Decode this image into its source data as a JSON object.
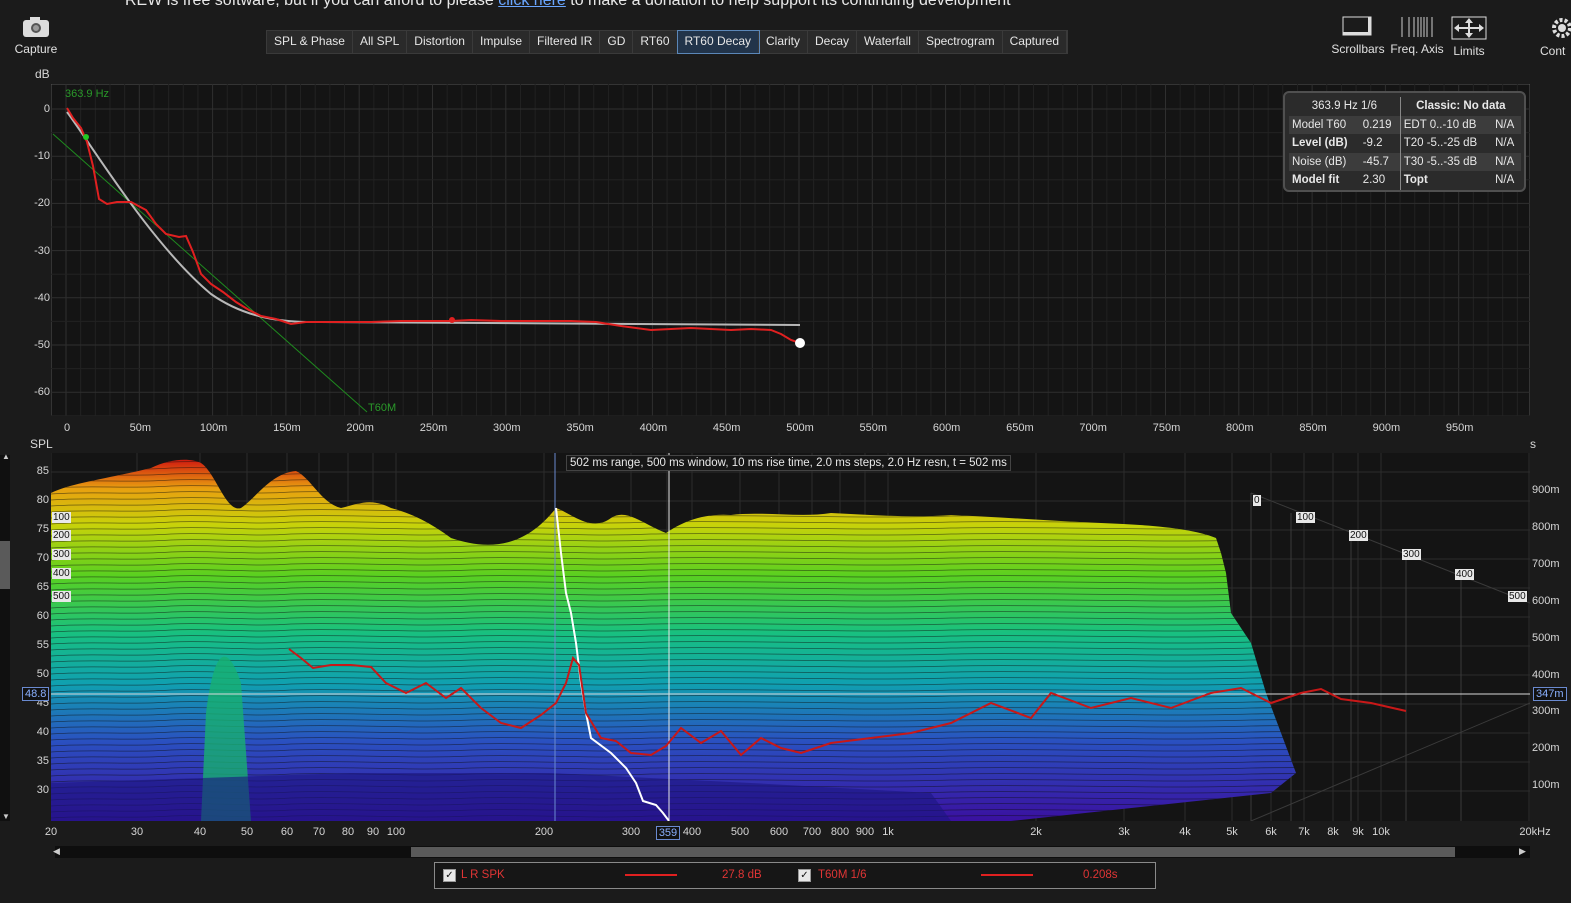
{
  "banner": {
    "text_before": "REW is free software, but if you can afford to please",
    "link": "click here",
    "text_after": "to make a donation to help support its continuing development"
  },
  "toolbar": {
    "capture": "Capture",
    "scrollbars": "Scrollbars",
    "freq_axis": "Freq. Axis",
    "limits": "Limits",
    "controls": "Cont"
  },
  "tabs": [
    "SPL & Phase",
    "All SPL",
    "Distortion",
    "Impulse",
    "Filtered IR",
    "GD",
    "RT60",
    "RT60 Decay",
    "Clarity",
    "Decay",
    "Waterfall",
    "Spectrogram",
    "Captured"
  ],
  "active_tab": "RT60 Decay",
  "decay_chart": {
    "y_unit": "dB",
    "y_ticks": [
      "0",
      "-10",
      "-20",
      "-30",
      "-40",
      "-50",
      "-60"
    ],
    "x_ticks": [
      "0",
      "50m",
      "100m",
      "150m",
      "200m",
      "250m",
      "300m",
      "350m",
      "400m",
      "450m",
      "500m",
      "550m",
      "600m",
      "650m",
      "700m",
      "750m",
      "800m",
      "850m",
      "900m",
      "950m"
    ],
    "freq_label": "363.9 Hz",
    "t60m_label": "T60M",
    "right_unit": "s"
  },
  "info_panel": {
    "header_left": "363.9 Hz 1/6",
    "header_right": "Classic: No data",
    "rows": [
      {
        "l_name": "Model T60",
        "l_val": "0.219",
        "r_name": "EDT 0..-10 dB",
        "r_val": "N/A"
      },
      {
        "l_name": "Level (dB)",
        "l_val": "-9.2",
        "r_name": "T20 -5..-25 dB",
        "r_val": "N/A"
      },
      {
        "l_name": "Noise (dB)",
        "l_val": "-45.7",
        "r_name": "T30 -5..-35 dB",
        "r_val": "N/A"
      },
      {
        "l_name": "Model fit",
        "l_val": "2.30",
        "r_name": "Topt",
        "r_val": "N/A"
      }
    ]
  },
  "waterfall": {
    "y_unit": "SPL",
    "y_ticks": [
      "85",
      "80",
      "75",
      "70",
      "65",
      "60",
      "55",
      "50",
      "45",
      "40",
      "35",
      "30"
    ],
    "cursor_spl": "48.8",
    "status": "502 ms range, 500 ms window, 10 ms rise time, 2.0 ms steps,  2.0 Hz resn, t = 502 ms",
    "x_ticks": [
      "20",
      "30",
      "40",
      "50",
      "60",
      "70",
      "80",
      "90",
      "100",
      "200",
      "300",
      "359",
      "400",
      "500",
      "600",
      "700",
      "800",
      "900",
      "1k",
      "2k",
      "3k",
      "4k",
      "5k",
      "6k",
      "7k",
      "8k",
      "9k",
      "10k",
      "20kHz"
    ],
    "time_ticks_right": [
      "900m",
      "800m",
      "700m",
      "600m",
      "500m",
      "400m",
      "300m",
      "200m",
      "100m"
    ],
    "cursor_time": "347m",
    "depth_labels": [
      "0",
      "100",
      "200",
      "300",
      "400",
      "500"
    ]
  },
  "legend": {
    "item1_name": "L R SPK",
    "item1_value": "27.8 dB",
    "item2_name": "T60M 1/6",
    "item2_value": "0.208s",
    "check": "✓"
  },
  "colors": {
    "trace": "#e02020",
    "fit": "#b0b0b0",
    "t60m": "#1f8a1f",
    "active_tab_border": "#5b87b8"
  }
}
